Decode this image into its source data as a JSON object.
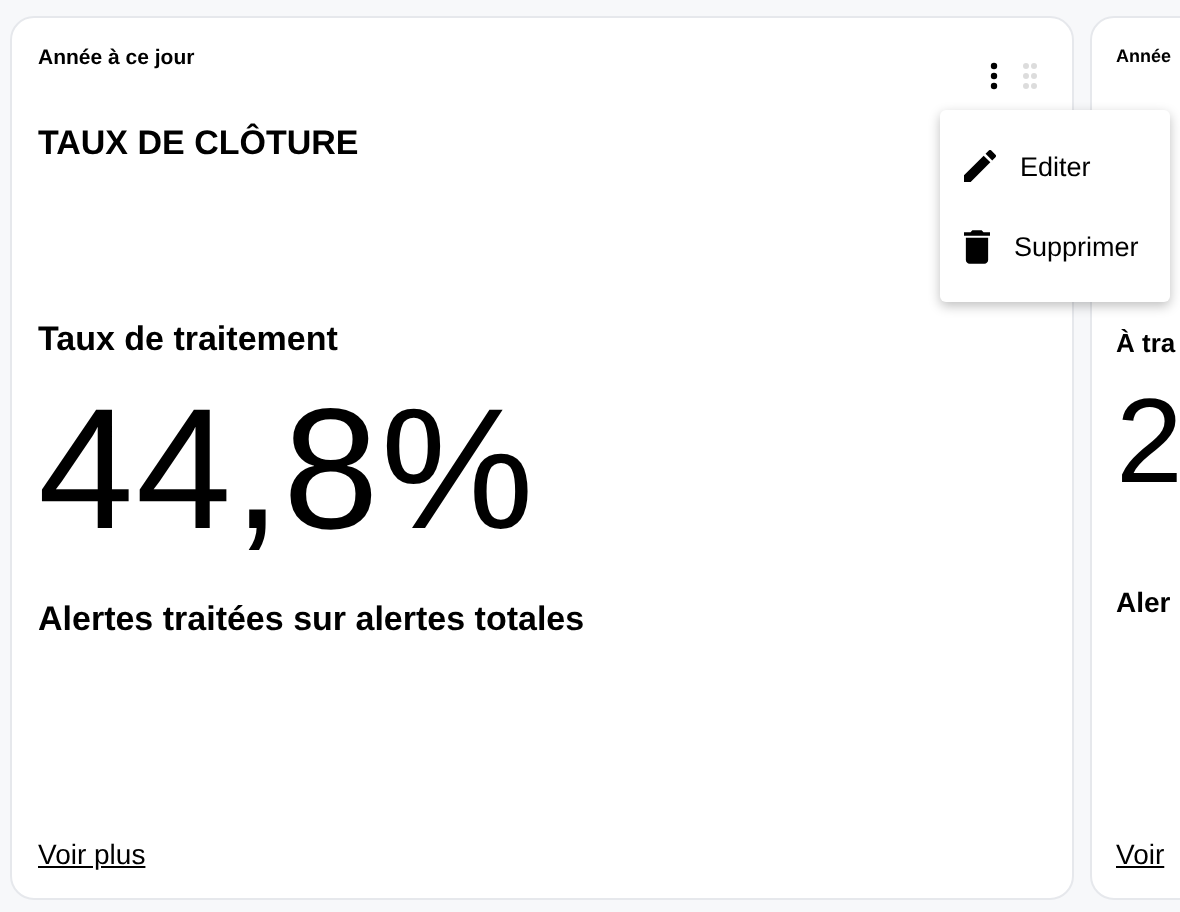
{
  "cards": [
    {
      "period": "Année à ce jour",
      "title": "TAUX DE CLÔTURE",
      "metric_label": "Taux de traitement",
      "value": "44,8%",
      "caption": "Alertes traitées sur alertes totales",
      "link": "Voir plus",
      "show_actions": true
    },
    {
      "period": "Année",
      "metric_label": "À tra",
      "value": "2",
      "caption": "Aler",
      "link": "Voir",
      "show_actions": false
    }
  ],
  "menu": {
    "items": [
      {
        "kind": "edit",
        "label": "Editer"
      },
      {
        "kind": "delete",
        "label": "Supprimer"
      }
    ]
  }
}
